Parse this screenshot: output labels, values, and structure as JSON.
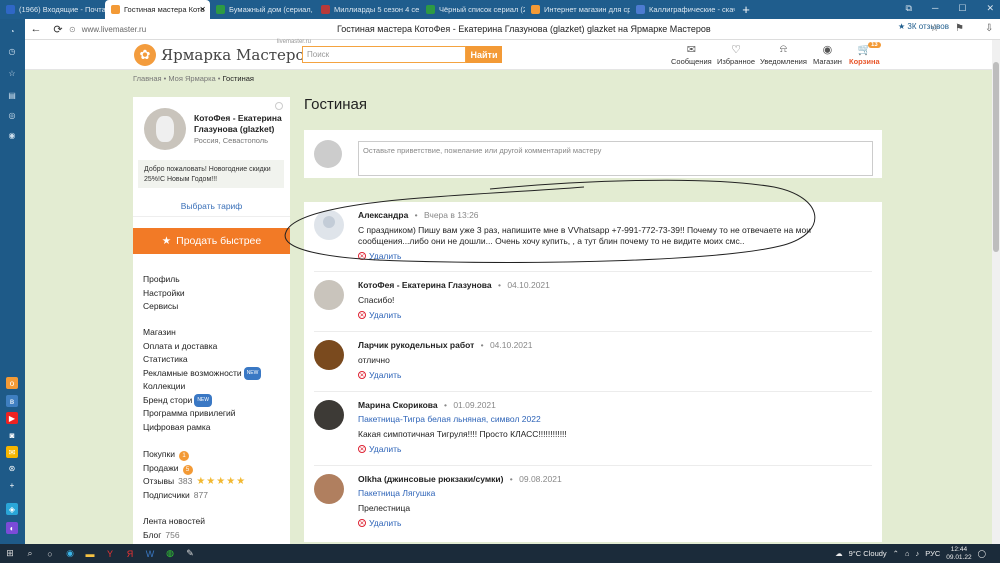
{
  "browser": {
    "tabs": [
      {
        "label": "(1966) Входящие - Почта",
        "color": "#2f67c6"
      },
      {
        "label": "Гостиная мастера Кото",
        "color": "#f39a36"
      },
      {
        "label": "Бумажный дом (сериал,",
        "color": "#2d9a43"
      },
      {
        "label": "Миллиарды 5 сезон 4 се",
        "color": "#b83a3a"
      },
      {
        "label": "Чёрный список сериал (2",
        "color": "#2d9a43"
      },
      {
        "label": "Интернет магазин для ср",
        "color": "#f39a36"
      },
      {
        "label": "Каллиграфические - скач",
        "color": "#4c7bd1"
      }
    ],
    "url": "www.livemaster.ru",
    "page_title": "Гостиная мастера КотоФея - Екатерина Глазунова (glazket) glazket на Ярмарке Мастеров",
    "reviews_link": "★ 3К отзывов"
  },
  "header": {
    "logo_name": "Ярмарка Мастеров",
    "logo_domain": "livemaster.ru",
    "search_placeholder": "Поиск",
    "find_label": "Найти",
    "menu": [
      {
        "label": "Сообщения",
        "icon": "mail-icon",
        "glyph": "✉"
      },
      {
        "label": "Избранное",
        "icon": "heart-icon",
        "glyph": "♡"
      },
      {
        "label": "Уведомления",
        "icon": "bell-icon",
        "glyph": "🔔"
      },
      {
        "label": "Магазин",
        "icon": "shop-avatar-icon",
        "glyph": "◉"
      }
    ],
    "cart_label": "Корзина",
    "cart_count": "13"
  },
  "breadcrumbs": {
    "home": "Главная",
    "sep": " • ",
    "my": "Моя Ярмарка",
    "current": "Гостиная"
  },
  "sidebar": {
    "name": "КотоФея - Екатерина Глазунова (glazket)",
    "location": "Россия, Севастополь",
    "welcome": "Добро пожаловать! Новогодние скидки 25%!С Новым Годом!!!",
    "tariff": "Выбрать тариф",
    "sell_button": "Продать быстрее",
    "group1": [
      "Профиль",
      "Настройки",
      "Сервисы"
    ],
    "group2": [
      "Магазин",
      "Оплата и доставка",
      "Статистика",
      "Рекламные возможности",
      "Коллекции",
      "Бренд стори",
      "Программа привилегий",
      "Цифровая рамка"
    ],
    "new_tag": "NEW",
    "purchases": "Покупки",
    "purchases_count": "1",
    "sales": "Продажи",
    "sales_count": "5",
    "reviews": "Отзывы",
    "reviews_count": "383",
    "rating_stars": "★★★★★",
    "subscribers": "Подписчики",
    "subscribers_count": "877",
    "news": "Лента новостей",
    "blog": "Блог",
    "blog_count": "756"
  },
  "main": {
    "title": "Гостиная",
    "comment_placeholder": "Оставьте приветствие, пожелание или другой комментарий мастеру",
    "delete_label": "Удалить",
    "comments": [
      {
        "author": "Александра",
        "date": "Вчера в 13:26",
        "link": "",
        "text": "С праздником) Пишу вам уже 3 раз, напишите мне в VVhatsapp +7-991-772-73-39!! Почему то не отвечаете на мои сообщения...либо они не дошли... Очень хочу купить, , а тут блин почему то не видите моих смс.."
      },
      {
        "author": "КотоФея - Екатерина Глазунова",
        "date": "04.10.2021",
        "link": "",
        "text": "Спасибо!"
      },
      {
        "author": "Ларчик рукодельных работ",
        "date": "04.10.2021",
        "link": "",
        "text": "отлично"
      },
      {
        "author": "Марина Скорикова",
        "date": "01.09.2021",
        "link": "Пакетница-Тигра белая льняная, символ 2022",
        "text": "Какая симпотичная Тигруля!!!! Просто КЛАСС!!!!!!!!!!!!"
      },
      {
        "author": "Olkha (джинсовые рюкзаки/сумки)",
        "date": "09.08.2021",
        "link": "Пакетница Лягушка",
        "text": "Прелестница"
      }
    ]
  },
  "taskbar": {
    "weather": "9°C  Cloudy",
    "lang": "РУС",
    "time": "12:44",
    "date": "09.01.22"
  }
}
